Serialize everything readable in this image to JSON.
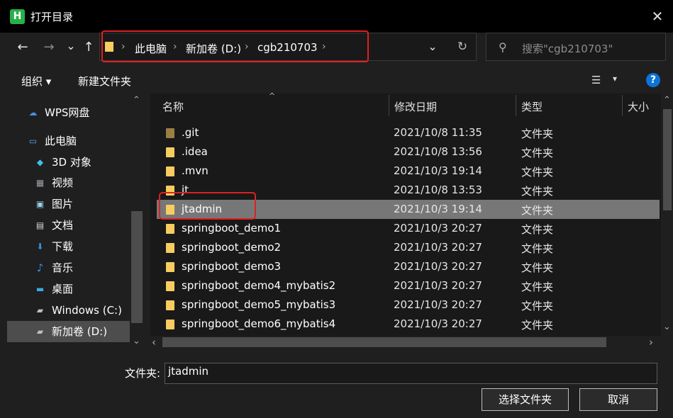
{
  "window": {
    "app_icon_glyph": "H",
    "title": "打开目录",
    "close_glyph": "✕"
  },
  "nav": {
    "back_glyph": "←",
    "forward_glyph": "→",
    "recent_glyph": "⌄",
    "up_glyph": "↑",
    "breadcrumb": [
      "此电脑",
      "新加卷 (D:)",
      "cgb210703"
    ],
    "breadcrumb_sep": "›",
    "dropdown_glyph": "⌄",
    "refresh_glyph": "↻",
    "search_glyph": "⚲",
    "search_placeholder": "搜索\"cgb210703\""
  },
  "toolbar": {
    "organize_label": "组织 ▾",
    "new_folder_label": "新建文件夹",
    "view_glyph": "☰",
    "view_dropdown_glyph": "▾",
    "help_glyph": "?"
  },
  "tree": {
    "items": [
      {
        "label": "WPS网盘",
        "icon": "cloud-icon",
        "glyph": "☁"
      },
      {
        "label": "此电脑",
        "icon": "computer-icon",
        "glyph": "▭"
      },
      {
        "label": "3D 对象",
        "icon": "cube-icon",
        "glyph": "◆"
      },
      {
        "label": "视频",
        "icon": "video-icon",
        "glyph": "▦"
      },
      {
        "label": "图片",
        "icon": "picture-icon",
        "glyph": "▣"
      },
      {
        "label": "文档",
        "icon": "document-icon",
        "glyph": "▤"
      },
      {
        "label": "下载",
        "icon": "download-icon",
        "glyph": "⬇"
      },
      {
        "label": "音乐",
        "icon": "music-icon",
        "glyph": "♪"
      },
      {
        "label": "桌面",
        "icon": "desktop-icon",
        "glyph": "▬"
      },
      {
        "label": "Windows (C:)",
        "icon": "drive-icon",
        "glyph": "▰"
      },
      {
        "label": "新加卷 (D:)",
        "icon": "drive-icon",
        "glyph": "▰"
      }
    ],
    "scroll_up_glyph": "⌃",
    "scroll_down_glyph": "⌄"
  },
  "list": {
    "sort_glyph": "^",
    "columns": [
      "名称",
      "修改日期",
      "类型",
      "大小"
    ],
    "rows": [
      {
        "name": ".git",
        "date": "2021/10/8 11:35",
        "type": "文件夹"
      },
      {
        "name": ".idea",
        "date": "2021/10/8 13:56",
        "type": "文件夹"
      },
      {
        "name": ".mvn",
        "date": "2021/10/3 19:14",
        "type": "文件夹"
      },
      {
        "name": "jt",
        "date": "2021/10/8 13:53",
        "type": "文件夹"
      },
      {
        "name": "jtadmin",
        "date": "2021/10/3 19:14",
        "type": "文件夹"
      },
      {
        "name": "springboot_demo1",
        "date": "2021/10/3 20:27",
        "type": "文件夹"
      },
      {
        "name": "springboot_demo2",
        "date": "2021/10/3 20:27",
        "type": "文件夹"
      },
      {
        "name": "springboot_demo3",
        "date": "2021/10/3 20:27",
        "type": "文件夹"
      },
      {
        "name": "springboot_demo4_mybatis2",
        "date": "2021/10/3 20:27",
        "type": "文件夹"
      },
      {
        "name": "springboot_demo5_mybatis3",
        "date": "2021/10/3 20:27",
        "type": "文件夹"
      },
      {
        "name": "springboot_demo6_mybatis4",
        "date": "2021/10/3 20:27",
        "type": "文件夹"
      }
    ],
    "scroll_up_glyph": "⌃",
    "scroll_down_glyph": "⌄",
    "scroll_left_glyph": "‹",
    "scroll_right_glyph": "›"
  },
  "footer": {
    "folder_label": "文件夹:",
    "folder_value": "jtadmin",
    "select_button": "选择文件夹",
    "cancel_button": "取消"
  },
  "colors": {
    "accent_blue": "#0a74da",
    "highlight_red": "#e02020",
    "folder_yellow": "#f7cd60",
    "selected_row": "#777777"
  }
}
